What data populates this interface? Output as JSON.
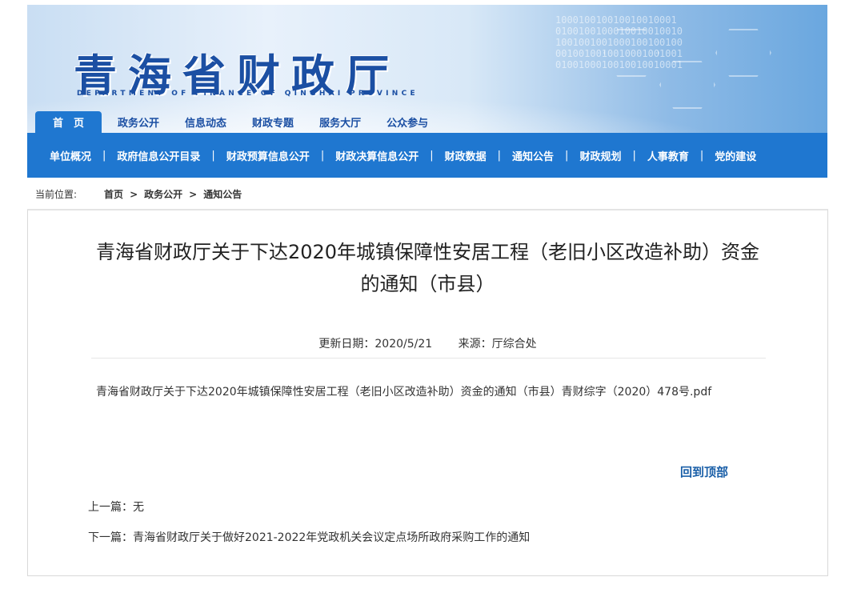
{
  "header": {
    "title_cn": "青海省财政厅",
    "title_en": "DEPARTMENT OF FINANCE OF QINGHAI PROVINCE",
    "tabs": [
      {
        "label": "首　页",
        "active": true
      },
      {
        "label": "政务公开"
      },
      {
        "label": "信息动态"
      },
      {
        "label": "财政专题"
      },
      {
        "label": "服务大厅"
      },
      {
        "label": "公众参与"
      }
    ]
  },
  "subnav": {
    "items": [
      "单位概况",
      "政府信息公开目录",
      "财政预算信息公开",
      "财政决算信息公开",
      "财政数据",
      "通知公告",
      "财政规划",
      "人事教育",
      "党的建设"
    ],
    "separator": "|"
  },
  "breadcrumb": {
    "label": "当前位置:",
    "items": [
      "首页",
      "政务公开",
      "通知公告"
    ],
    "arrow": ">"
  },
  "article": {
    "title_line1": "青海省财政厅关于下达2020年城镇保障性安居工程（老旧小区改造补助）资金",
    "title_line2": "的通知（市县）",
    "updated": "更新日期：2020/5/21",
    "source": "来源：厅综合处",
    "attachment": "青海省财政厅关于下达2020年城镇保障性安居工程（老旧小区改造补助）资金的通知（市县）青财综字（2020）478号.pdf",
    "back_to_top": "回到顶部",
    "prev": "上一篇：无",
    "next": "下一篇：青海省财政厅关于做好2021-2022年党政机关会议定点场所政府采购工作的通知"
  },
  "colors": {
    "nav_blue": "#1f77d0",
    "logo_blue": "#1b4fa3",
    "link_blue": "#1a5fa8"
  }
}
